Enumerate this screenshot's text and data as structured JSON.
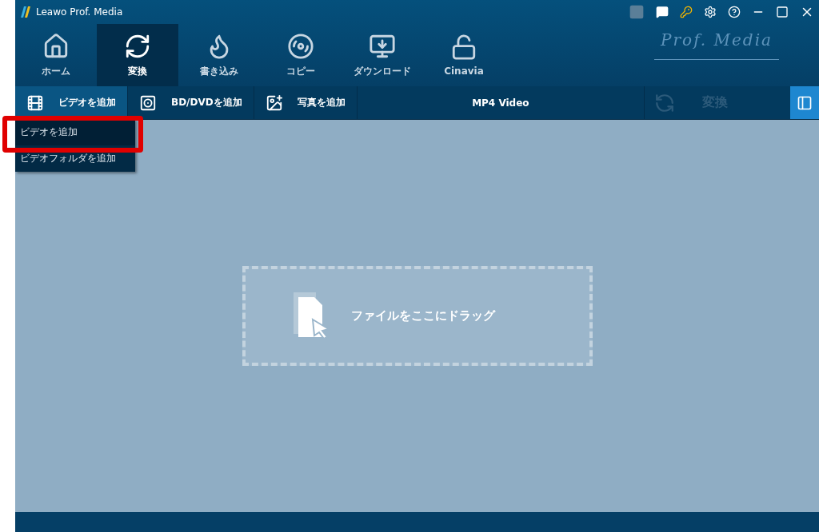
{
  "window": {
    "title": "Leawo Prof. Media"
  },
  "nav_tabs": [
    {
      "kind": "home",
      "label": "ホーム",
      "selected": false
    },
    {
      "kind": "convert",
      "label": "変換",
      "selected": true
    },
    {
      "kind": "burn",
      "label": "書き込み",
      "selected": false
    },
    {
      "kind": "copy",
      "label": "コピー",
      "selected": false
    },
    {
      "kind": "download",
      "label": "ダウンロード",
      "selected": false
    },
    {
      "kind": "cinavia",
      "label": "Cinavia",
      "selected": false
    }
  ],
  "logo": {
    "text": "Prof. Media"
  },
  "toolbar": {
    "buttons": [
      {
        "kind": "video",
        "label": "ビデオを追加",
        "active": true
      },
      {
        "kind": "disc",
        "label": "BD/DVDを追加",
        "active": false
      },
      {
        "kind": "photo",
        "label": "写真を追加",
        "active": false
      }
    ],
    "profile": "MP4 Video",
    "convert": {
      "label": "変換",
      "disabled": true
    }
  },
  "dropdown": {
    "items": [
      {
        "label": "ビデオを追加",
        "selected": true
      },
      {
        "label": "ビデオフォルダを追加",
        "selected": false
      }
    ]
  },
  "drop_zone": {
    "text": "ファイルをここにドラッグ"
  }
}
